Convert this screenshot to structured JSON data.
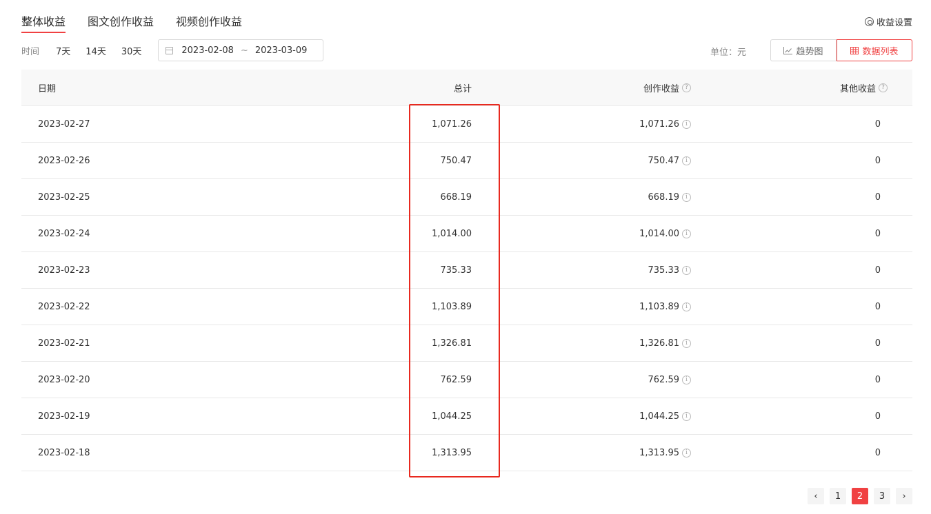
{
  "tabs": [
    {
      "label": "整体收益",
      "active": true
    },
    {
      "label": "图文创作收益",
      "active": false
    },
    {
      "label": "视频创作收益",
      "active": false
    }
  ],
  "settings_label": "收益设置",
  "filter": {
    "label": "时间",
    "options": [
      "7天",
      "14天",
      "30天"
    ],
    "start_date": "2023-02-08",
    "separator": "~",
    "end_date": "2023-03-09"
  },
  "unit_label": "单位：元",
  "view_buttons": {
    "trend": "趋势图",
    "list": "数据列表"
  },
  "table": {
    "headers": [
      "日期",
      "总计",
      "创作收益",
      "其他收益"
    ],
    "rows": [
      {
        "date": "2023-02-27",
        "total": "1,071.26",
        "creation": "1,071.26",
        "other": "0"
      },
      {
        "date": "2023-02-26",
        "total": "750.47",
        "creation": "750.47",
        "other": "0"
      },
      {
        "date": "2023-02-25",
        "total": "668.19",
        "creation": "668.19",
        "other": "0"
      },
      {
        "date": "2023-02-24",
        "total": "1,014.00",
        "creation": "1,014.00",
        "other": "0"
      },
      {
        "date": "2023-02-23",
        "total": "735.33",
        "creation": "735.33",
        "other": "0"
      },
      {
        "date": "2023-02-22",
        "total": "1,103.89",
        "creation": "1,103.89",
        "other": "0"
      },
      {
        "date": "2023-02-21",
        "total": "1,326.81",
        "creation": "1,326.81",
        "other": "0"
      },
      {
        "date": "2023-02-20",
        "total": "762.59",
        "creation": "762.59",
        "other": "0"
      },
      {
        "date": "2023-02-19",
        "total": "1,044.25",
        "creation": "1,044.25",
        "other": "0"
      },
      {
        "date": "2023-02-18",
        "total": "1,313.95",
        "creation": "1,313.95",
        "other": "0"
      }
    ]
  },
  "pagination": {
    "prev": "‹",
    "pages": [
      "1",
      "2",
      "3"
    ],
    "current": "2",
    "next": "›"
  },
  "colors": {
    "accent": "#f04142",
    "highlight_box": "#e8291f"
  }
}
